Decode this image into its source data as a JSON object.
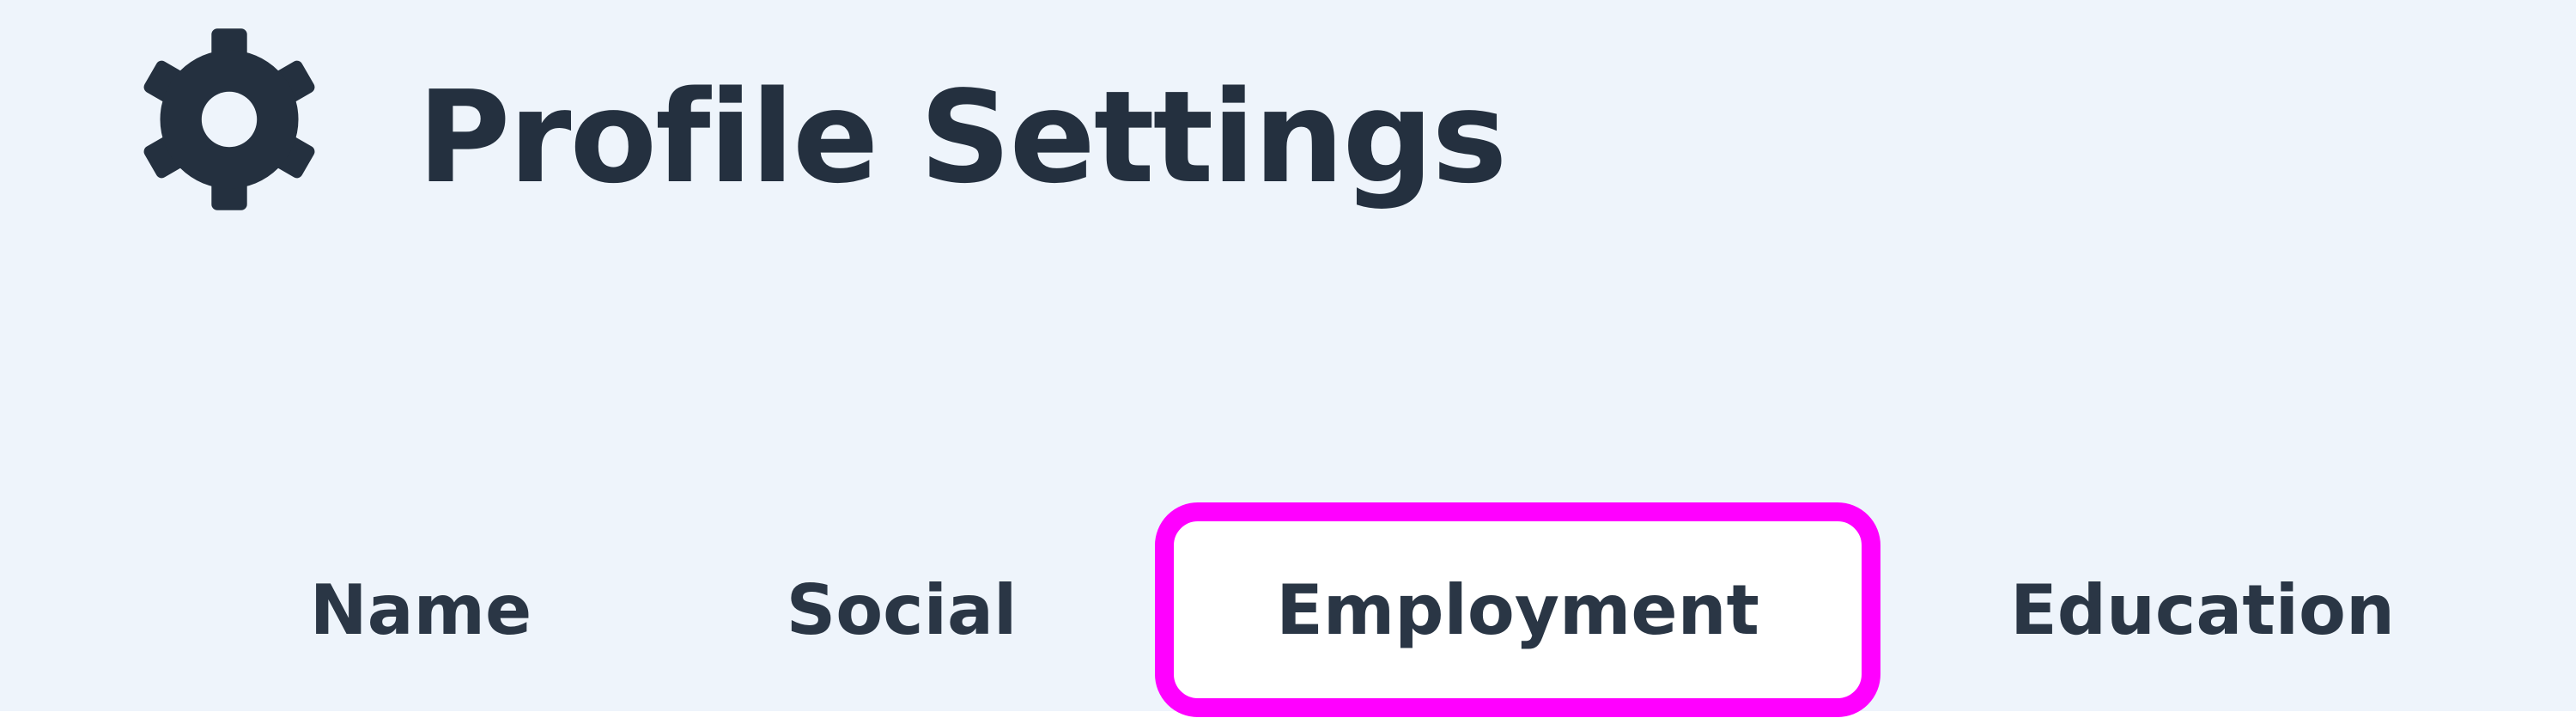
{
  "header": {
    "icon": "gear-icon",
    "title": "Profile Settings"
  },
  "tabs": [
    {
      "label": "Name"
    },
    {
      "label": "Social"
    },
    {
      "label": "Employment",
      "selected": true
    },
    {
      "label": "Education"
    }
  ],
  "colors": {
    "background": "#eef4fb",
    "text": "#24303f",
    "highlight": "#ff00ff",
    "active_tab_background": "#ffffff"
  }
}
